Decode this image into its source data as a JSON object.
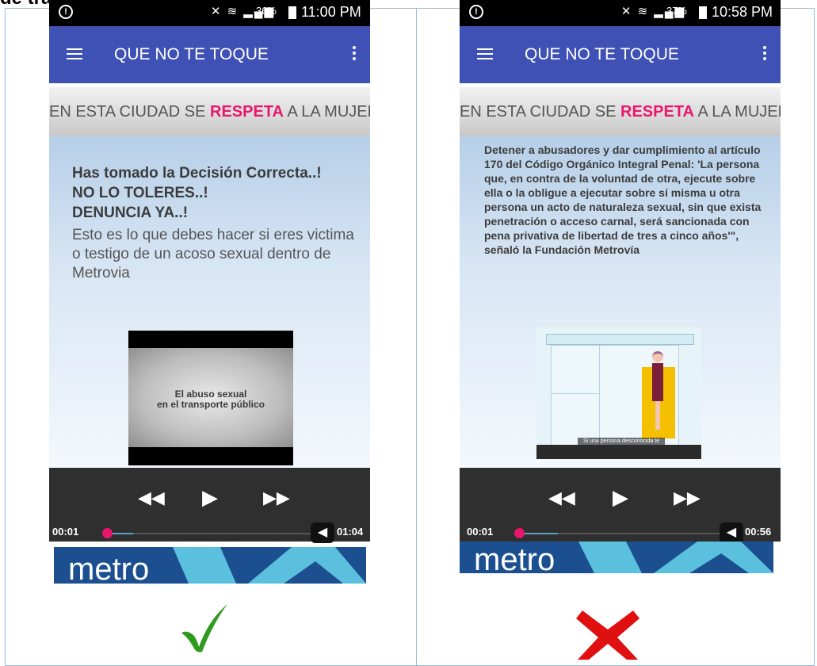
{
  "heading": "de transporte:",
  "phones": [
    {
      "status": {
        "battery": "36%",
        "time": "11:00 PM"
      },
      "app_title": "QUE NO TE TOQUE",
      "banner": {
        "pre": "EN ESTA CIUDAD SE ",
        "emph": "RESPETA",
        "post": " A LA MUJER"
      },
      "headline": [
        "Has tomado la Decisión Correcta..!",
        "NO LO TOLERES..!",
        "DENUNCIA YA..!"
      ],
      "body": "Esto es lo que debes hacer si eres victima o testigo de un acoso sexual dentro de Metrovia",
      "video_caption": [
        "El abuso sexual",
        "en el transporte público"
      ],
      "player": {
        "current": "00:01",
        "duration": "01:04",
        "progress": 0.02
      },
      "logo_text": "metro",
      "verdict": "check-mark-icon",
      "verdict_color": "#2e9b1e"
    },
    {
      "status": {
        "battery": "37%",
        "time": "10:58 PM"
      },
      "app_title": "QUE NO TE TOQUE",
      "banner": {
        "pre": "EN ESTA CIUDAD SE ",
        "emph": "RESPETA",
        "post": " A LA MUJER"
      },
      "body": "Detener a abusadores y dar cumplimiento al artículo 170 del Código Orgánico Integral Penal: 'La persona que, en contra de la voluntad de otra, ejecute sobre ella o la obligue a ejecutar sobre sí misma u otra persona un acto de naturaleza sexual, sin que exista penetración o acceso carnal, será sancionada con pena privativa de libertad de tres a cinco años'\", señaló la Fundación Metrovía",
      "video_subtitle": "Si una persona desconocida te hace comentarios sexuales",
      "player": {
        "current": "00:01",
        "duration": "00:56",
        "progress": 0.02
      },
      "logo_text": "metro",
      "verdict": "cross-mark-icon",
      "verdict_color": "#e01010"
    }
  ],
  "colors": {
    "appbar": "#3f51b5",
    "accent": "#e8176c",
    "logo_bg": "#1b4f90",
    "logo_shape": "#5bc0de"
  }
}
